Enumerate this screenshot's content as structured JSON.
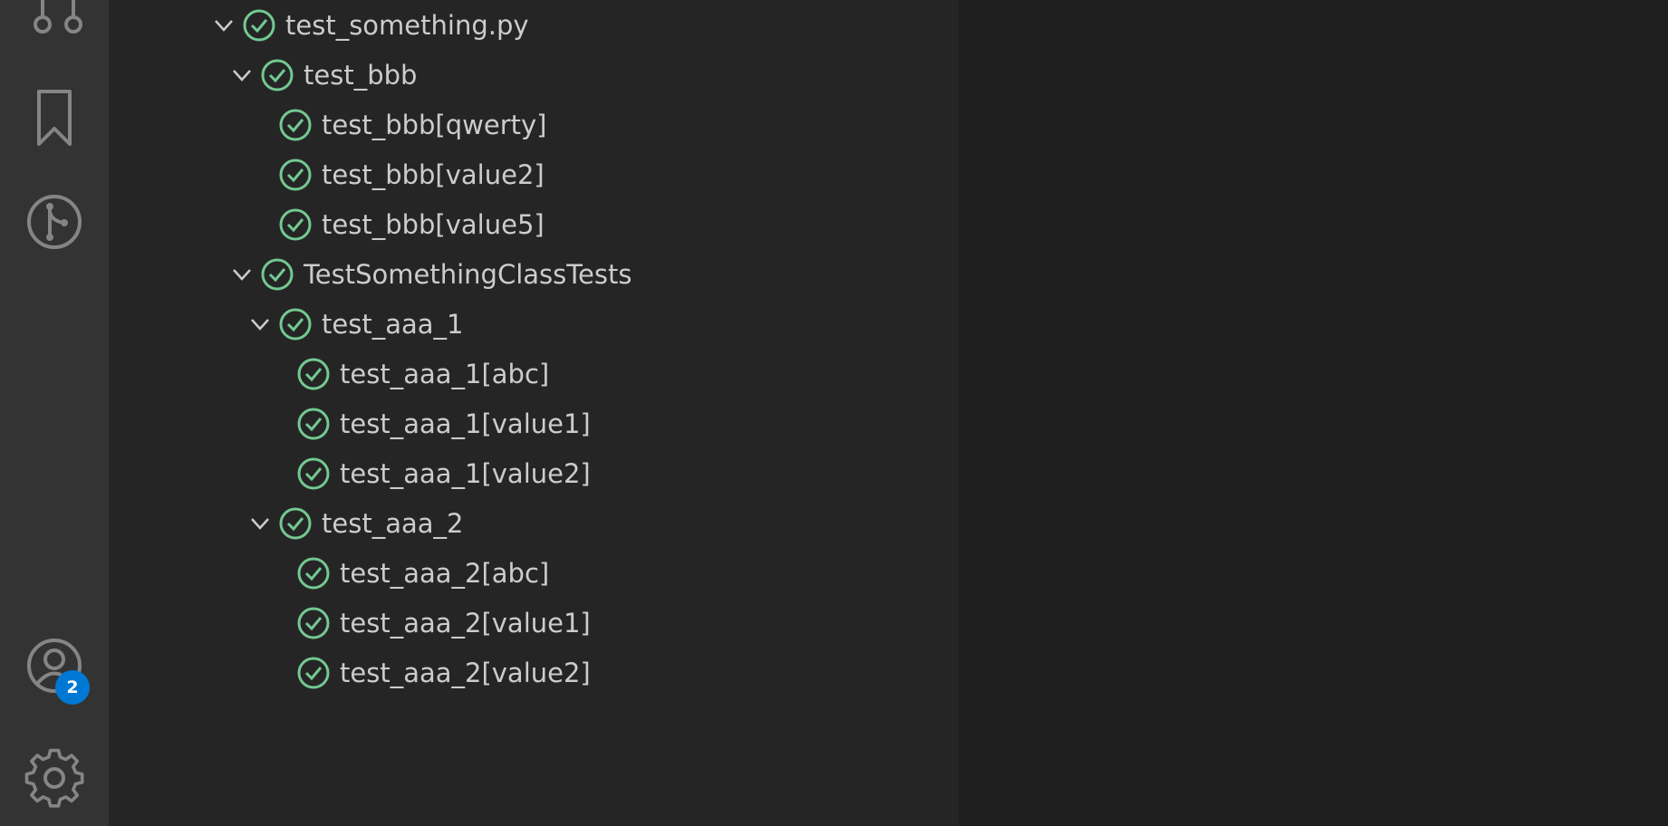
{
  "colors": {
    "activity_bar": "#333333",
    "sidebar": "#252526",
    "editor": "#1e1e1e",
    "text": "#cccccc",
    "passed": "#73c991",
    "badge": "#0078d4",
    "icon": "#858585"
  },
  "activity_bar": {
    "items": [
      {
        "icon": "source-control-icon"
      },
      {
        "icon": "bookmark-icon"
      },
      {
        "icon": "git-graph-icon"
      },
      {
        "icon": "account-icon"
      },
      {
        "icon": "gear-icon"
      }
    ],
    "accounts_badge": "2"
  },
  "test_tree": {
    "file": {
      "label": "test_something.py",
      "status": "passed",
      "expanded": true
    },
    "group_bbb": {
      "label": "test_bbb",
      "status": "passed",
      "expanded": true
    },
    "bbb_items": [
      {
        "label": "test_bbb[qwerty]",
        "status": "passed"
      },
      {
        "label": "test_bbb[value2]",
        "status": "passed"
      },
      {
        "label": "test_bbb[value5]",
        "status": "passed"
      }
    ],
    "class_group": {
      "label": "TestSomethingClassTests",
      "status": "passed",
      "expanded": true
    },
    "group_aaa_1": {
      "label": "test_aaa_1",
      "status": "passed",
      "expanded": true
    },
    "aaa_1_items": [
      {
        "label": "test_aaa_1[abc]",
        "status": "passed"
      },
      {
        "label": "test_aaa_1[value1]",
        "status": "passed"
      },
      {
        "label": "test_aaa_1[value2]",
        "status": "passed"
      }
    ],
    "group_aaa_2": {
      "label": "test_aaa_2",
      "status": "passed",
      "expanded": true
    },
    "aaa_2_items": [
      {
        "label": "test_aaa_2[abc]",
        "status": "passed"
      },
      {
        "label": "test_aaa_2[value1]",
        "status": "passed"
      },
      {
        "label": "test_aaa_2[value2]",
        "status": "passed"
      }
    ]
  }
}
